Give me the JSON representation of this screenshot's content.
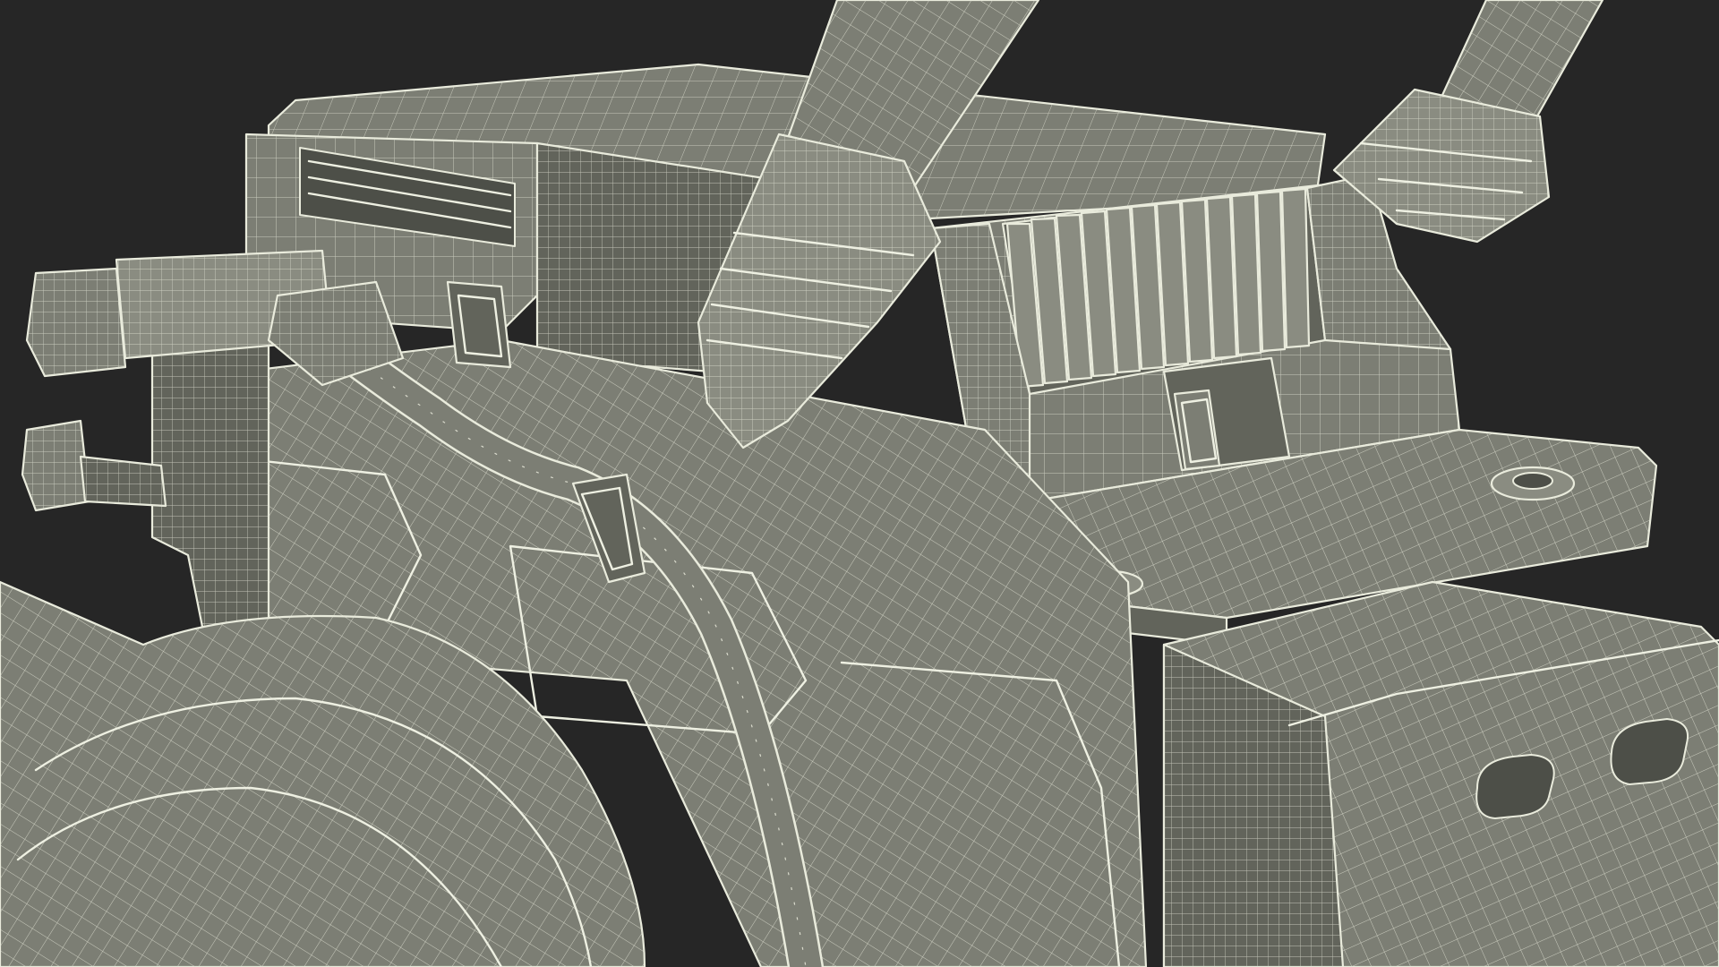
{
  "scene": {
    "background_color": "#262626",
    "model_fill_color": "#7c7e74",
    "wireframe_color": "#e9ebdc",
    "render_style": "wireframe-on-shaded",
    "text": []
  }
}
